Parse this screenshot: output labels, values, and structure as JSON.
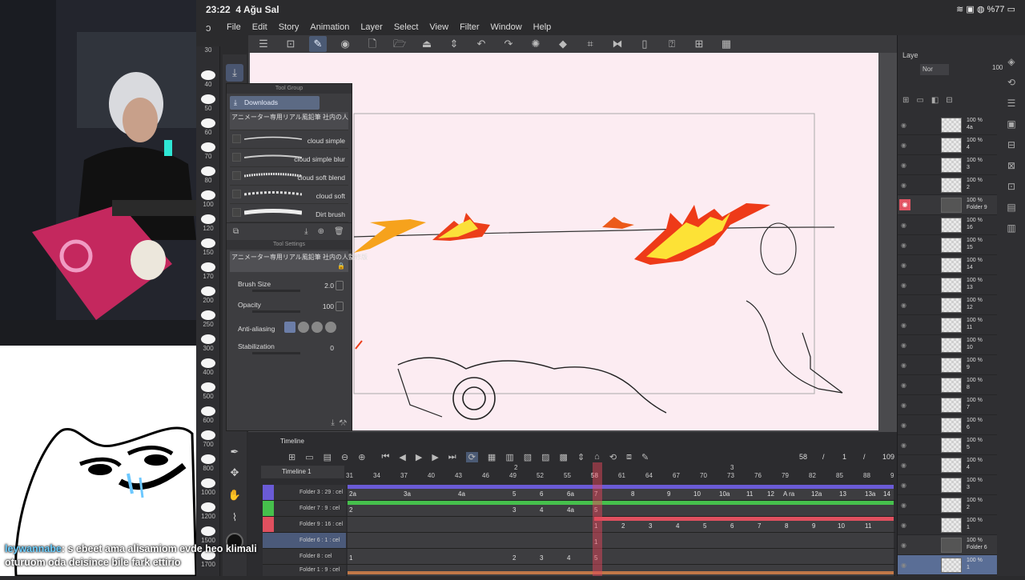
{
  "status_bar": {
    "time": "23:22",
    "date": "4 Ağu Sal",
    "battery": "%77"
  },
  "menu": {
    "items": [
      "File",
      "Edit",
      "Story",
      "Animation",
      "Layer",
      "Select",
      "View",
      "Filter",
      "Window",
      "Help"
    ]
  },
  "brush_sizes": [
    "30",
    "40",
    "50",
    "60",
    "70",
    "80",
    "100",
    "120",
    "150",
    "170",
    "200",
    "250",
    "300",
    "400",
    "500",
    "600",
    "700",
    "800",
    "1000",
    "1200",
    "1500",
    "1700"
  ],
  "subtool_panel": {
    "title": "Tool Group",
    "group": "Downloads",
    "selected_brush": "アニメーター専用リアル風鉛筆 社内の人",
    "brushes": [
      "cloud simple",
      "cloud simple blur",
      "cloud soft blend",
      "cloud soft",
      "Dirt brush"
    ]
  },
  "tool_settings": {
    "title": "Tool Settings",
    "brush_name": "アニメーター専用リアル風鉛筆 社内の人監修版",
    "brush_size_label": "Brush Size",
    "brush_size": "2.0",
    "opacity_label": "Opacity",
    "opacity": "100",
    "antialiasing_label": "Anti-aliasing",
    "stabilization_label": "Stabilization",
    "stabilization": "0"
  },
  "layer_panel": {
    "tab": "Laye",
    "blend": "Nor",
    "opacity": "100",
    "layers": [
      {
        "pct": "100 %",
        "name": "4a"
      },
      {
        "pct": "100 %",
        "name": "4"
      },
      {
        "pct": "100 %",
        "name": "3"
      },
      {
        "pct": "100 %",
        "name": "2"
      },
      {
        "pct": "100 %",
        "name": "Folder 9",
        "folder": true
      },
      {
        "pct": "100 %",
        "name": "16"
      },
      {
        "pct": "100 %",
        "name": "15"
      },
      {
        "pct": "100 %",
        "name": "14"
      },
      {
        "pct": "100 %",
        "name": "13"
      },
      {
        "pct": "100 %",
        "name": "12"
      },
      {
        "pct": "100 %",
        "name": "11"
      },
      {
        "pct": "100 %",
        "name": "10"
      },
      {
        "pct": "100 %",
        "name": "9"
      },
      {
        "pct": "100 %",
        "name": "8"
      },
      {
        "pct": "100 %",
        "name": "7"
      },
      {
        "pct": "100 %",
        "name": "6"
      },
      {
        "pct": "100 %",
        "name": "5"
      },
      {
        "pct": "100 %",
        "name": "4"
      },
      {
        "pct": "100 %",
        "name": "3"
      },
      {
        "pct": "100 %",
        "name": "2"
      },
      {
        "pct": "100 %",
        "name": "1"
      },
      {
        "pct": "100 %",
        "name": "Folder 6",
        "folder": true
      },
      {
        "pct": "100 %",
        "name": "1"
      }
    ]
  },
  "timeline": {
    "tab": "Timeline",
    "name": "Timeline 1",
    "current_frame": "58",
    "page": "1",
    "total": "109",
    "marker_labels": [
      "2",
      "3"
    ],
    "ruler": [
      "31",
      "34",
      "37",
      "40",
      "43",
      "46",
      "49",
      "52",
      "55",
      "58",
      "61",
      "64",
      "67",
      "70",
      "73",
      "76",
      "79",
      "82",
      "85",
      "88",
      "9"
    ],
    "tracks": [
      {
        "name": "Folder 3 : 29 : cel",
        "color": "#6a5bd6",
        "cells": [
          "2a",
          "3a",
          "4a",
          "5",
          "6",
          "6a",
          "7",
          "8",
          "9",
          "10",
          "10a",
          "11",
          "12",
          "A ra",
          "12a",
          "13",
          "13a",
          "14"
        ]
      },
      {
        "name": "Folder 7 : 9 : cel",
        "color": "#46c04c",
        "cells": [
          "2",
          "3",
          "4",
          "4a",
          "5"
        ]
      },
      {
        "name": "Folder 9 : 16 : cel",
        "color": "#e0505f",
        "cells": [
          "1",
          "2",
          "3",
          "4",
          "5",
          "6",
          "7",
          "8",
          "9",
          "10",
          "11"
        ]
      },
      {
        "name": "Folder 6 : 1 : cel",
        "color": "#5d6fa0",
        "cells": [
          "1"
        ]
      },
      {
        "name": "Folder 8 : cel",
        "color": "#c07848",
        "cells": [
          "1",
          "2",
          "3",
          "4",
          "5"
        ]
      },
      {
        "name": "Folder 1 : 9 : cel",
        "color": "#c07848",
        "cells": []
      }
    ]
  },
  "chat": {
    "user": "leywannabe",
    "message_line1": ": s ebeet ama alisamiom evde heo klimali",
    "message_line2": "oturuom oda deisince bile fark ettirio"
  }
}
